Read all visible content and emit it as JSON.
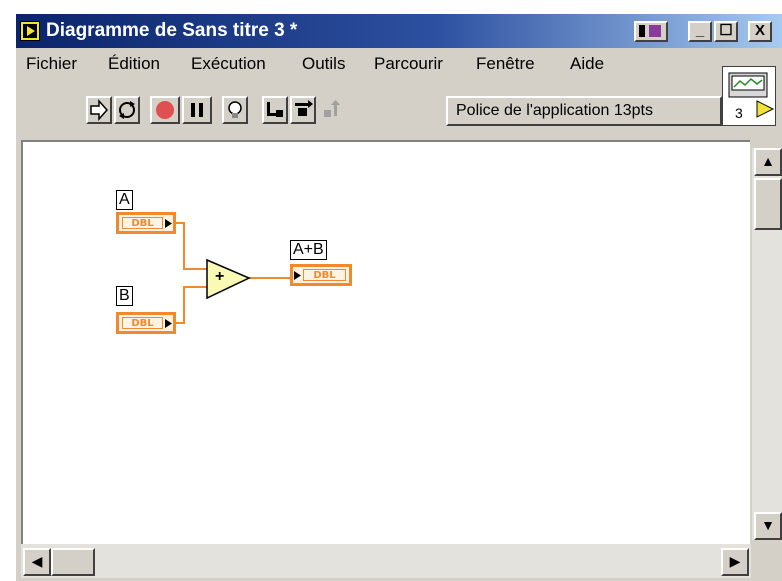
{
  "window": {
    "title": "Diagramme de Sans titre 3 *",
    "buttons": {
      "minimize": "_",
      "maximize": "☐",
      "close": "X"
    }
  },
  "menu": [
    "Fichier",
    "Édition",
    "Exécution",
    "Outils",
    "Parcourir",
    "Fenêtre",
    "Aide"
  ],
  "toolbar": {
    "font_label": "Police de l'application 13pts",
    "icons": [
      "run-arrow-icon",
      "run-continuous-icon",
      "abort-icon",
      "pause-icon",
      "highlight-execution-icon",
      "step-into-icon",
      "step-over-icon",
      "step-out-icon"
    ]
  },
  "connector_pane": {
    "number": "3"
  },
  "diagram": {
    "controls": [
      {
        "label": "A",
        "type": "DBL"
      },
      {
        "label": "B",
        "type": "DBL"
      }
    ],
    "indicator": {
      "label": "A+B",
      "type": "DBL"
    },
    "function": {
      "symbol": "+"
    }
  },
  "colors": {
    "dbl_orange": "#f08a2c",
    "title_blue": "#0a246a",
    "add_node": "#fafab4"
  }
}
